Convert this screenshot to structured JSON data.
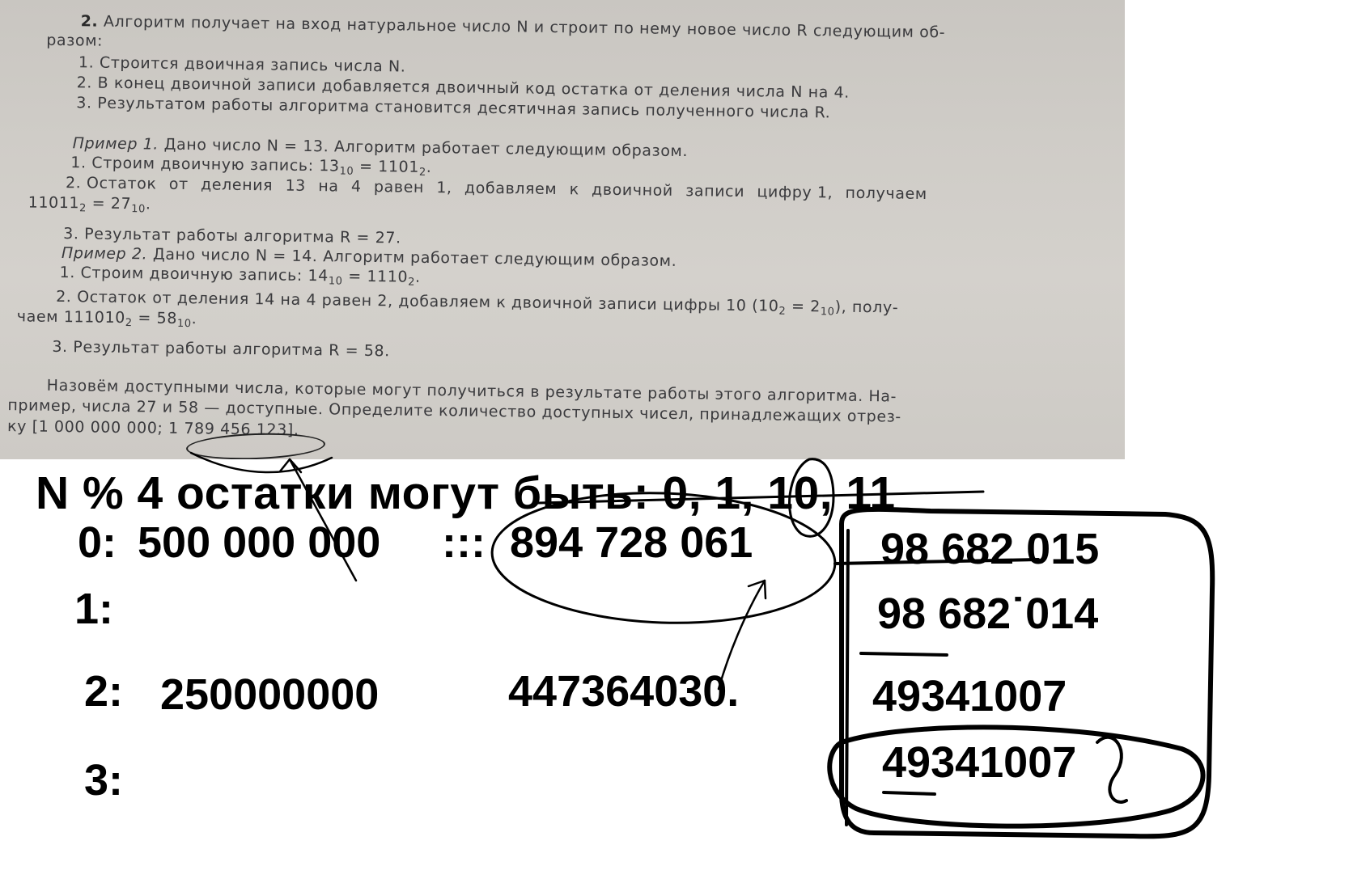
{
  "photo": {
    "task_number": "2.",
    "intro_1": "Алгоритм получает на вход натуральное число N и строит по нему новое число R следующим об-",
    "intro_2": "разом:",
    "step_1": "1. Строится двоичная запись числа N.",
    "step_2": "2. В конец двоичной записи добавляется двоичный код остатка от деления числа N на 4.",
    "step_3": "3. Результатом работы алгоритма становится десятичная запись полученного числа R.",
    "ex1_head": "Пример 1.",
    "ex1_text": "Дано число N = 13. Алгоритм работает следующим образом.",
    "ex1_s1": "1. Строим двоичную запись: 13",
    "ex1_s1_sub_a": "10",
    "ex1_s1_mid": " = 1101",
    "ex1_s1_sub_b": "2",
    "ex1_s1_end": ".",
    "ex1_s2_words": [
      "2. Остаток",
      "от",
      "деления",
      "13",
      "на",
      "4",
      "равен",
      "1,",
      "добавляем",
      "к",
      "двоичной",
      "записи",
      "цифру 1,",
      "получаем"
    ],
    "ex1_s2b_a": "11011",
    "ex1_s2b_sub_a": "2",
    "ex1_s2b_mid": " = 27",
    "ex1_s2b_sub_b": "10",
    "ex1_s2b_end": ".",
    "ex1_s3": "3. Результат работы алгоритма R = 27.",
    "ex2_head": "Пример 2.",
    "ex2_text": "Дано число N = 14. Алгоритм работает следующим образом.",
    "ex2_s1": "1. Строим двоичную запись: 14",
    "ex2_s1_sub_a": "10",
    "ex2_s1_mid": " = 1110",
    "ex2_s1_sub_b": "2",
    "ex2_s1_end": ".",
    "ex2_s2": "2. Остаток от деления 14 на 4 равен 2, добавляем к двоичной записи цифры 10 (10",
    "ex2_s2_sub_a": "2",
    "ex2_s2_mid": " = 2",
    "ex2_s2_sub_b": "10",
    "ex2_s2_end": "), полу-",
    "ex2_s2b_a": "чаем 111010",
    "ex2_s2b_sub_a": "2",
    "ex2_s2b_mid": " = 58",
    "ex2_s2b_sub_b": "10",
    "ex2_s2b_end": ".",
    "ex2_s3": "3. Результат работы алгоритма R = 58.",
    "q_1": "Назовём доступными числа, которые могут получиться в результате работы этого алгоритма. На-",
    "q_2": "пример, числа 27 и 58 — доступные. Определите количество доступных чисел, принадлежащих отрез-",
    "q_3": "ку [1 000 000 000; 1 789 456 123]."
  },
  "notes": {
    "heading": "N % 4 остатки могут быть: 0, 1, 10, 11",
    "row0_label": "0:",
    "row0_a": "500 000 000",
    "row0_sep": ":::",
    "row0_b": "894 728 061",
    "row1_label": "1:",
    "row2_label": "2:",
    "row2_a": "250000000",
    "row2_b": "447364030.",
    "row3_label": "3:",
    "box_1": "98 682 015",
    "box_2": "98 682˙014",
    "box_3": "49341007",
    "box_4": "49341007"
  }
}
